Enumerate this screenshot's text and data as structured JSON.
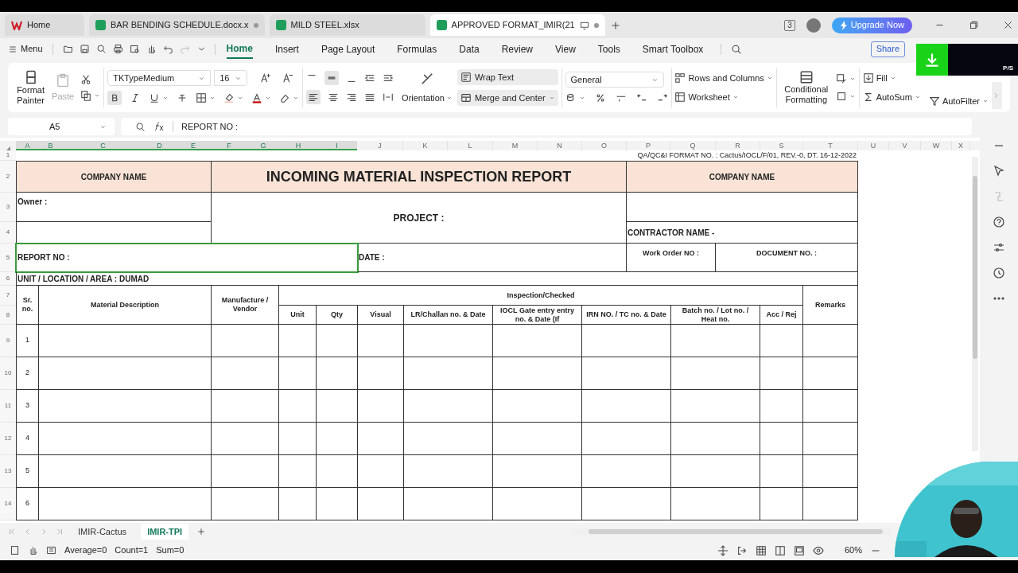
{
  "title_tabs": [
    {
      "label": "Home",
      "kind": "home",
      "selected": false,
      "modified": false
    },
    {
      "label": "BAR BENDING SCHEDULE.docx.x",
      "kind": "sheet",
      "selected": false,
      "modified": true
    },
    {
      "label": "MILD STEEL.xlsx",
      "kind": "sheet",
      "selected": false,
      "modified": false
    },
    {
      "label": "APPROVED FORMAT_IMIR(21",
      "kind": "sheet",
      "selected": true,
      "modified": true
    }
  ],
  "window_actions": {
    "upgrade": "Upgrade Now",
    "badge": "3"
  },
  "menu": {
    "label": "Menu",
    "tabs": [
      {
        "label": "Home",
        "selected": true
      },
      {
        "label": "Insert",
        "selected": false
      },
      {
        "label": "Page Layout",
        "selected": false
      },
      {
        "label": "Formulas",
        "selected": false
      },
      {
        "label": "Data",
        "selected": false
      },
      {
        "label": "Review",
        "selected": false
      },
      {
        "label": "View",
        "selected": false
      },
      {
        "label": "Tools",
        "selected": false
      },
      {
        "label": "Smart Toolbox",
        "selected": false
      }
    ],
    "share": "Share"
  },
  "ribbon": {
    "format_painter": "Format Painter",
    "paste": {
      "label": "Paste",
      "disabled": true
    },
    "font": "TKTypeMedium",
    "font_size": "16",
    "bold": true,
    "wrap_text": "Wrap Text",
    "orientation": "Orientation",
    "merge": "Merge and Center",
    "number_format": "General",
    "rows_columns": "Rows and Columns",
    "worksheet": "Worksheet",
    "conditional": "Conditional Formatting",
    "fill": "Fill",
    "autosum": "AutoSum",
    "autofilter": "AutoFilter"
  },
  "overlay_badge": "P/S",
  "formula_bar": {
    "name_box": "A5",
    "formula": "REPORT NO :"
  },
  "column_headers": [
    {
      "label": "A",
      "selected": true
    },
    {
      "label": "B",
      "selected": true
    },
    {
      "label": "C",
      "selected": true
    },
    {
      "label": "D",
      "selected": true
    },
    {
      "label": "E",
      "selected": true
    },
    {
      "label": "F",
      "selected": true
    },
    {
      "label": "G",
      "selected": true
    },
    {
      "label": "H",
      "selected": true
    },
    {
      "label": "I",
      "selected": true
    },
    {
      "label": "J",
      "selected": false
    },
    {
      "label": "K",
      "selected": false
    },
    {
      "label": "L",
      "selected": false
    },
    {
      "label": "M",
      "selected": false
    },
    {
      "label": "N",
      "selected": false
    },
    {
      "label": "O",
      "selected": false
    },
    {
      "label": "P",
      "selected": false
    },
    {
      "label": "Q",
      "selected": false
    },
    {
      "label": "R",
      "selected": false
    },
    {
      "label": "S",
      "selected": false
    },
    {
      "label": "T",
      "selected": false
    },
    {
      "label": "U",
      "selected": false
    },
    {
      "label": "V",
      "selected": false
    },
    {
      "label": "W",
      "selected": false
    },
    {
      "label": "X",
      "selected": false
    }
  ],
  "row_numbers": [
    "1",
    "2",
    "3",
    "4",
    "5",
    "6",
    "7",
    "8",
    "9",
    "10",
    "11",
    "12",
    "13",
    "14"
  ],
  "form": {
    "format_no": "QA/QC&I FORMAT NO. : Cactus/IOCL/F/01, REV.-0, DT. 16-12-2022",
    "company_left": "COMPANY NAME",
    "title": "INCOMING MATERIAL INSPECTION REPORT",
    "company_right": "COMPANY NAME",
    "owner": "Owner :",
    "project": "PROJECT :",
    "contractor": "CONTRACTOR NAME -",
    "report_no": {
      "text": "REPORT NO :",
      "selected": true
    },
    "date": "DATE :",
    "work_order": "Work Order NO :",
    "document_no": "DOCUMENT NO. :",
    "location": "UNIT / LOCATION / AREA : DUMAD"
  },
  "table": {
    "sr": "Sr. no.",
    "material": "Material Description",
    "manufacture": "Manufacture / Vendor",
    "inspection": "Inspection/Checked",
    "sub_columns": [
      "Unit",
      "Qty",
      "Visual",
      "LR/Challan no. & Date",
      "IOCL Gate entry entry no. & Date (If",
      "IRN NO. / TC no. & Date",
      "Batch no. / Lot no. / Heat no.",
      "Acc / Rej"
    ],
    "remarks": "Remarks",
    "rows": [
      "1",
      "2",
      "3",
      "4",
      "5",
      "6"
    ]
  },
  "sheet_tabs": [
    {
      "label": "IMIR-Cactus",
      "selected": false
    },
    {
      "label": "IMIR-TPI",
      "selected": true
    }
  ],
  "status_bar": {
    "stats": [
      "Average=0",
      "Count=1",
      "Sum=0"
    ],
    "zoom": "60%"
  }
}
